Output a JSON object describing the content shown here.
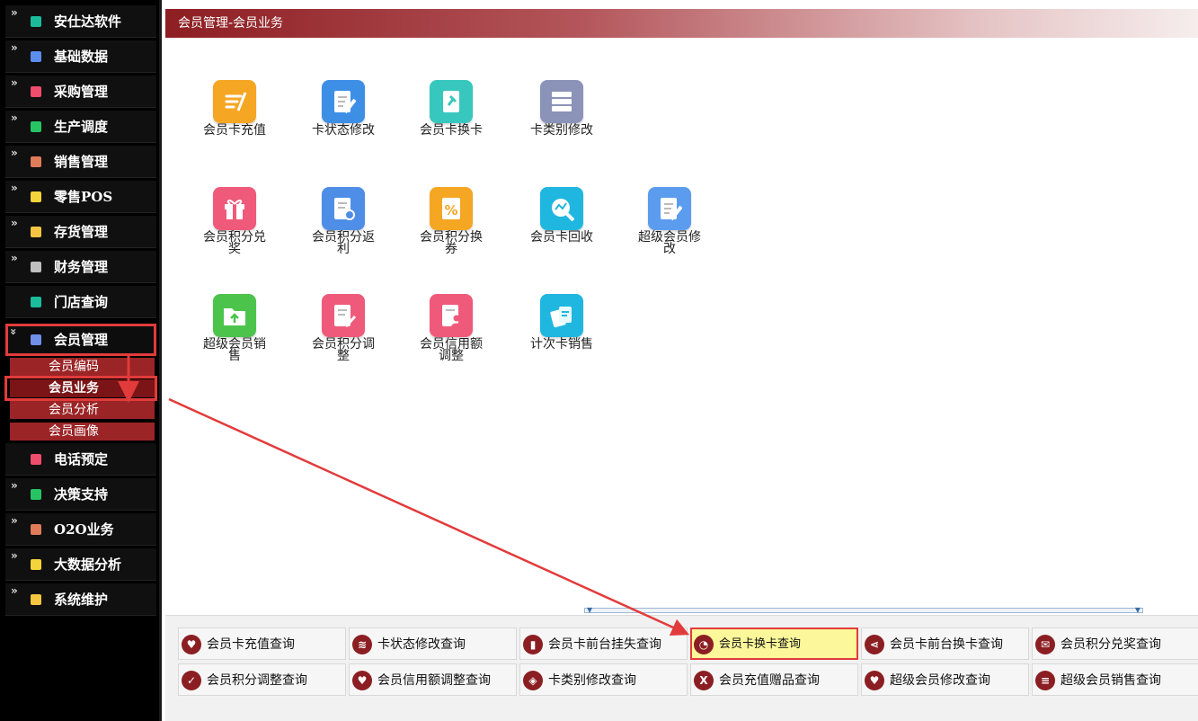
{
  "sidebar": {
    "items": [
      {
        "label": "安仕达软件",
        "icon": "software-icon",
        "color": "#1abc9c"
      },
      {
        "label": "基础数据",
        "icon": "data-icon",
        "color": "#5b8def"
      },
      {
        "label": "采购管理",
        "icon": "purchase-icon",
        "color": "#ef4d6d"
      },
      {
        "label": "生产调度",
        "icon": "production-icon",
        "color": "#27c463"
      },
      {
        "label": "销售管理",
        "icon": "sales-icon",
        "color": "#e07b59"
      },
      {
        "label": "零售POS",
        "icon": "pos-icon",
        "color": "#f5d33a"
      },
      {
        "label": "存货管理",
        "icon": "inventory-icon",
        "color": "#f5c542"
      },
      {
        "label": "财务管理",
        "icon": "finance-icon",
        "color": "#bfbfbf"
      },
      {
        "label": "门店查询",
        "icon": "store-icon",
        "color": "#1abc9c"
      },
      {
        "label": "会员管理",
        "icon": "member-icon",
        "color": "#6f8fe8"
      },
      {
        "label": "电话预定",
        "icon": "phone-icon",
        "color": "#ef4d6d"
      },
      {
        "label": "决策支持",
        "icon": "decision-icon",
        "color": "#27c463"
      },
      {
        "label": "O2O业务",
        "icon": "o2o-icon",
        "color": "#e07b59"
      },
      {
        "label": "大数据分析",
        "icon": "bigdata-icon",
        "color": "#f5d33a"
      },
      {
        "label": "系统维护",
        "icon": "system-icon",
        "color": "#f5c542"
      }
    ],
    "sub_items": [
      "会员编码",
      "会员业务",
      "会员分析",
      "会员画像"
    ]
  },
  "header": {
    "title": "会员管理-会员业务"
  },
  "tiles": [
    {
      "label": "会员卡充值",
      "icon": "recharge-icon",
      "color": "#f5a623"
    },
    {
      "label": "卡状态修改",
      "icon": "edit-doc-icon",
      "color": "#3d8fe6"
    },
    {
      "label": "会员卡换卡",
      "icon": "pin-card-icon",
      "color": "#37c7be"
    },
    {
      "label": "卡类别修改",
      "icon": "server-icon",
      "color": "#8b93b8"
    },
    {
      "label": "会员积分兑奖",
      "icon": "gift-icon",
      "color": "#ef5a7a"
    },
    {
      "label": "会员积分返利",
      "icon": "doc-gear-icon",
      "color": "#4f8ee6"
    },
    {
      "label": "会员积分换券",
      "icon": "percent-icon",
      "color": "#f5a623"
    },
    {
      "label": "会员卡回收",
      "icon": "search-chart-icon",
      "color": "#1fb7e0"
    },
    {
      "label": "超级会员修改",
      "icon": "edit-doc-icon",
      "color": "#5b9cef"
    },
    {
      "label": "超级会员销售",
      "icon": "folder-upload-icon",
      "color": "#4cc44c"
    },
    {
      "label": "会员积分调整",
      "icon": "doc-check-icon",
      "color": "#ef5a7a"
    },
    {
      "label": "会员信用额调整",
      "icon": "doc-user-icon",
      "color": "#ef5a7a"
    },
    {
      "label": "计次卡销售",
      "icon": "cards-icon",
      "color": "#1fb7e0"
    }
  ],
  "queries": [
    {
      "label": "会员卡充值查询",
      "icon": "heart-icon",
      "glyph": "♥"
    },
    {
      "label": "卡状态修改查询",
      "icon": "layers-icon",
      "glyph": "≋"
    },
    {
      "label": "会员卡前台挂失查询",
      "icon": "bar-chart-icon",
      "glyph": "▮"
    },
    {
      "label": "会员卡换卡查询",
      "icon": "pie-icon",
      "glyph": "◔"
    },
    {
      "label": "会员卡前台换卡查询",
      "icon": "share-icon",
      "glyph": "⋖"
    },
    {
      "label": "会员积分兑奖查询",
      "icon": "chat-icon",
      "glyph": "✉"
    },
    {
      "label": "会员积分调整查询",
      "icon": "check-icon",
      "glyph": "✓"
    },
    {
      "label": "会员信用额调整查询",
      "icon": "heart-icon",
      "glyph": "♥"
    },
    {
      "label": "卡类别修改查询",
      "icon": "tag-icon",
      "glyph": "◈"
    },
    {
      "label": "会员充值赠品查询",
      "icon": "x-icon",
      "glyph": "X"
    },
    {
      "label": "超级会员修改查询",
      "icon": "heart-icon",
      "glyph": "♥"
    },
    {
      "label": "超级会员销售查询",
      "icon": "db-icon",
      "glyph": "≡"
    }
  ]
}
